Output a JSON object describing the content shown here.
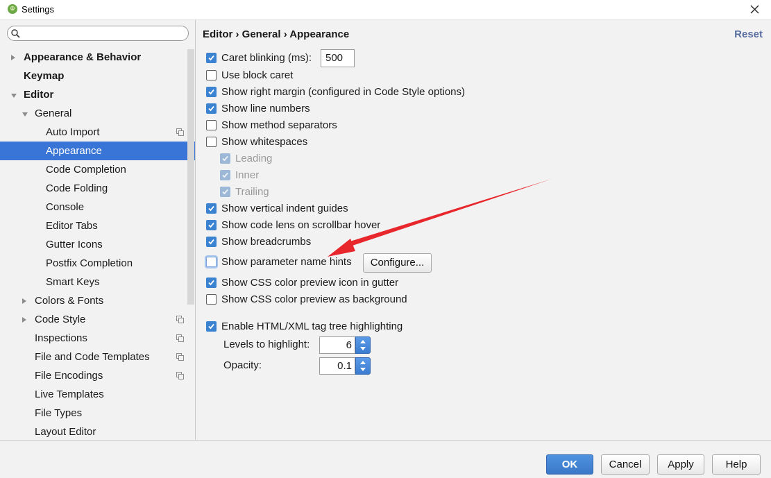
{
  "window": {
    "title": "Settings",
    "app_icon": "android-icon",
    "close_icon": "close-icon"
  },
  "search": {
    "icon": "search-icon",
    "value": "",
    "placeholder": ""
  },
  "sidebar": {
    "items": [
      {
        "label": "Appearance & Behavior",
        "level": 0,
        "bold": true,
        "expander": "collapsed"
      },
      {
        "label": "Keymap",
        "level": 0,
        "bold": true,
        "expander": "none"
      },
      {
        "label": "Editor",
        "level": 0,
        "bold": true,
        "expander": "expanded"
      },
      {
        "label": "General",
        "level": 1,
        "bold": false,
        "expander": "expanded"
      },
      {
        "label": "Auto Import",
        "level": 2,
        "bold": false,
        "expander": "none",
        "project_icon": true
      },
      {
        "label": "Appearance",
        "level": 2,
        "bold": false,
        "expander": "none",
        "selected": true
      },
      {
        "label": "Code Completion",
        "level": 2,
        "bold": false,
        "expander": "none"
      },
      {
        "label": "Code Folding",
        "level": 2,
        "bold": false,
        "expander": "none"
      },
      {
        "label": "Console",
        "level": 2,
        "bold": false,
        "expander": "none"
      },
      {
        "label": "Editor Tabs",
        "level": 2,
        "bold": false,
        "expander": "none"
      },
      {
        "label": "Gutter Icons",
        "level": 2,
        "bold": false,
        "expander": "none"
      },
      {
        "label": "Postfix Completion",
        "level": 2,
        "bold": false,
        "expander": "none"
      },
      {
        "label": "Smart Keys",
        "level": 2,
        "bold": false,
        "expander": "none"
      },
      {
        "label": "Colors & Fonts",
        "level": 1,
        "bold": false,
        "expander": "collapsed"
      },
      {
        "label": "Code Style",
        "level": 1,
        "bold": false,
        "expander": "collapsed",
        "project_icon": true
      },
      {
        "label": "Inspections",
        "level": 1,
        "bold": false,
        "expander": "none",
        "project_icon": true
      },
      {
        "label": "File and Code Templates",
        "level": 1,
        "bold": false,
        "expander": "none",
        "project_icon": true
      },
      {
        "label": "File Encodings",
        "level": 1,
        "bold": false,
        "expander": "none",
        "project_icon": true
      },
      {
        "label": "Live Templates",
        "level": 1,
        "bold": false,
        "expander": "none"
      },
      {
        "label": "File Types",
        "level": 1,
        "bold": false,
        "expander": "none"
      },
      {
        "label": "Layout Editor",
        "level": 1,
        "bold": false,
        "expander": "none"
      }
    ]
  },
  "header": {
    "breadcrumb": "Editor › General › Appearance",
    "reset": "Reset"
  },
  "options": {
    "caret_blinking": {
      "label": "Caret blinking (ms):",
      "checked": true,
      "value": "500"
    },
    "block_caret": {
      "label": "Use block caret",
      "checked": false
    },
    "right_margin": {
      "label": "Show right margin (configured in Code Style options)",
      "checked": true
    },
    "line_numbers": {
      "label": "Show line numbers",
      "checked": true
    },
    "method_separators": {
      "label": "Show method separators",
      "checked": false
    },
    "whitespaces": {
      "label": "Show whitespaces",
      "checked": false
    },
    "leading": {
      "label": "Leading",
      "checked": true,
      "disabled": true
    },
    "inner": {
      "label": "Inner",
      "checked": true,
      "disabled": true
    },
    "trailing": {
      "label": "Trailing",
      "checked": true,
      "disabled": true
    },
    "indent_guides": {
      "label": "Show vertical indent guides",
      "checked": true
    },
    "code_lens": {
      "label": "Show code lens on scrollbar hover",
      "checked": true
    },
    "breadcrumbs": {
      "label": "Show breadcrumbs",
      "checked": true
    },
    "param_hints": {
      "label": "Show parameter name hints",
      "checked": false,
      "focused": true
    },
    "configure_button": "Configure...",
    "css_icon": {
      "label": "Show CSS color preview icon in gutter",
      "checked": true
    },
    "css_background": {
      "label": "Show CSS color preview as background",
      "checked": false
    },
    "tag_tree": {
      "label": "Enable HTML/XML tag tree highlighting",
      "checked": true
    },
    "levels": {
      "label": "Levels to highlight:",
      "value": "6"
    },
    "opacity": {
      "label": "Opacity:",
      "value": "0.1"
    }
  },
  "buttons": {
    "ok": "OK",
    "cancel": "Cancel",
    "apply": "Apply",
    "help": "Help"
  },
  "colors": {
    "selection": "#3875d7",
    "checkbox": "#3b83d1",
    "annotation_arrow": "#e8272c"
  }
}
